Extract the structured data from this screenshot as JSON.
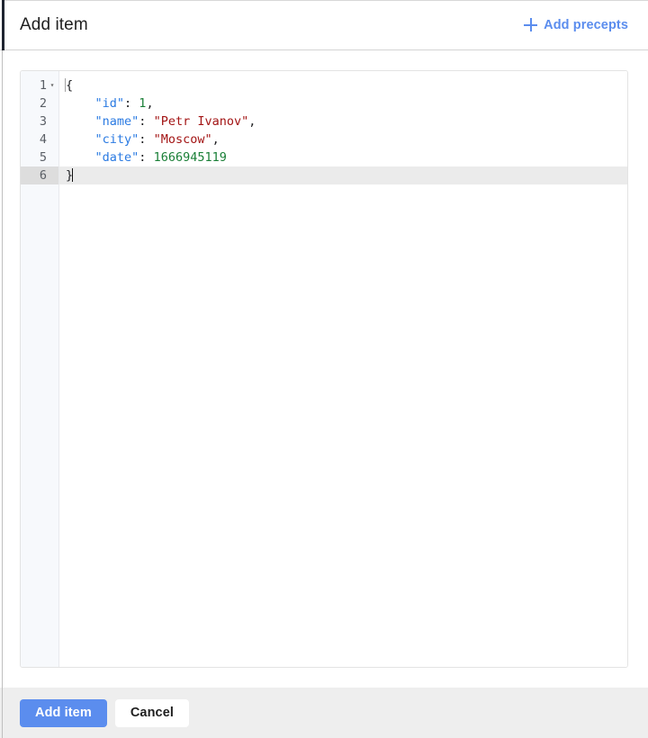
{
  "header": {
    "title": "Add item",
    "add_precepts_label": "Add precepts",
    "plus_icon": "plus-icon",
    "accent_color": "#5b8dee"
  },
  "editor": {
    "language": "json",
    "active_line": 6,
    "lines": [
      {
        "number": "1",
        "foldable": true,
        "fold_glyph": "▾",
        "tokens": [
          {
            "text": "{",
            "type": "punct"
          }
        ]
      },
      {
        "number": "2",
        "foldable": false,
        "fold_glyph": "",
        "tokens": [
          {
            "text": "    ",
            "type": "punct"
          },
          {
            "text": "\"id\"",
            "type": "key"
          },
          {
            "text": ": ",
            "type": "punct"
          },
          {
            "text": "1",
            "type": "num"
          },
          {
            "text": ",",
            "type": "punct"
          }
        ]
      },
      {
        "number": "3",
        "foldable": false,
        "fold_glyph": "",
        "tokens": [
          {
            "text": "    ",
            "type": "punct"
          },
          {
            "text": "\"name\"",
            "type": "key"
          },
          {
            "text": ": ",
            "type": "punct"
          },
          {
            "text": "\"Petr Ivanov\"",
            "type": "str"
          },
          {
            "text": ",",
            "type": "punct"
          }
        ]
      },
      {
        "number": "4",
        "foldable": false,
        "fold_glyph": "",
        "tokens": [
          {
            "text": "    ",
            "type": "punct"
          },
          {
            "text": "\"city\"",
            "type": "key"
          },
          {
            "text": ": ",
            "type": "punct"
          },
          {
            "text": "\"Moscow\"",
            "type": "str"
          },
          {
            "text": ",",
            "type": "punct"
          }
        ]
      },
      {
        "number": "5",
        "foldable": false,
        "fold_glyph": "",
        "tokens": [
          {
            "text": "    ",
            "type": "punct"
          },
          {
            "text": "\"date\"",
            "type": "key"
          },
          {
            "text": ": ",
            "type": "punct"
          },
          {
            "text": "1666945119",
            "type": "num"
          }
        ]
      },
      {
        "number": "6",
        "foldable": false,
        "fold_glyph": "",
        "tokens": [
          {
            "text": "}",
            "type": "punct"
          }
        ]
      }
    ],
    "document_text": "{\n    \"id\": 1,\n    \"name\": \"Petr Ivanov\",\n    \"city\": \"Moscow\",\n    \"date\": 1666945119\n}",
    "colors": {
      "key": "#2a7ae2",
      "string": "#a31515",
      "number": "#1a7f37",
      "punctuation": "#202124",
      "gutter_background": "#f7f9fc",
      "active_line_background": "#ebebeb",
      "active_gutter_background": "#dddddd"
    }
  },
  "footer": {
    "submit_label": "Add item",
    "cancel_label": "Cancel",
    "submit_color": "#5b8dee",
    "background": "#eeeeee"
  }
}
